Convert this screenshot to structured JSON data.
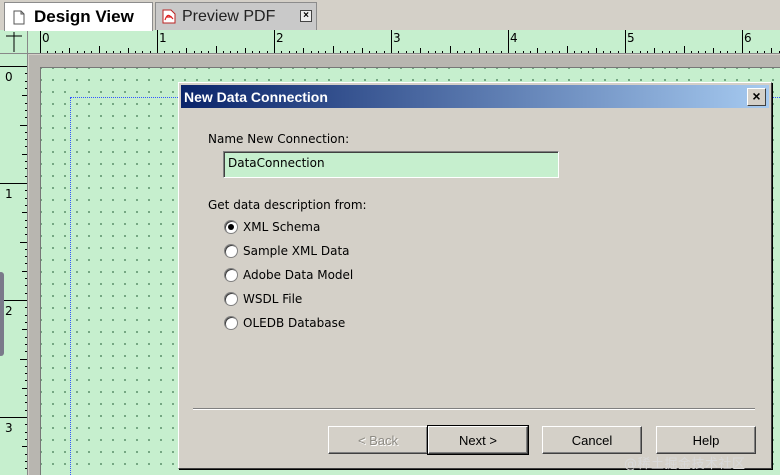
{
  "tabs": [
    {
      "label": "Design View",
      "icon": "document-icon",
      "active": true
    },
    {
      "label": "Preview PDF",
      "icon": "pdf-icon",
      "active": false,
      "close_label": "×"
    }
  ],
  "ruler": {
    "horizontal_labels": [
      "0",
      "1",
      "2",
      "3",
      "4",
      "5",
      "6"
    ],
    "vertical_labels": [
      "0",
      "1",
      "2",
      "3"
    ]
  },
  "dialog": {
    "title": "New Data Connection",
    "close_label": "×",
    "name_label": "Name New Connection:",
    "name_value": "DataConnection",
    "source_label": "Get data description from:",
    "options": [
      {
        "label": "XML Schema",
        "checked": true
      },
      {
        "label": "Sample XML Data",
        "checked": false
      },
      {
        "label": "Adobe Data Model",
        "checked": false
      },
      {
        "label": "WSDL File",
        "checked": false
      },
      {
        "label": "OLEDB Database",
        "checked": false
      }
    ],
    "buttons": {
      "back": "< Back",
      "next": "Next >",
      "cancel": "Cancel",
      "help": "Help"
    }
  },
  "watermark": "@稀土掘金技术社区",
  "colors": {
    "page_background": "#c6efce",
    "title_gradient_start": "#0a246a",
    "title_gradient_end": "#a6caf0",
    "dialog_face": "#d4d0c8"
  }
}
